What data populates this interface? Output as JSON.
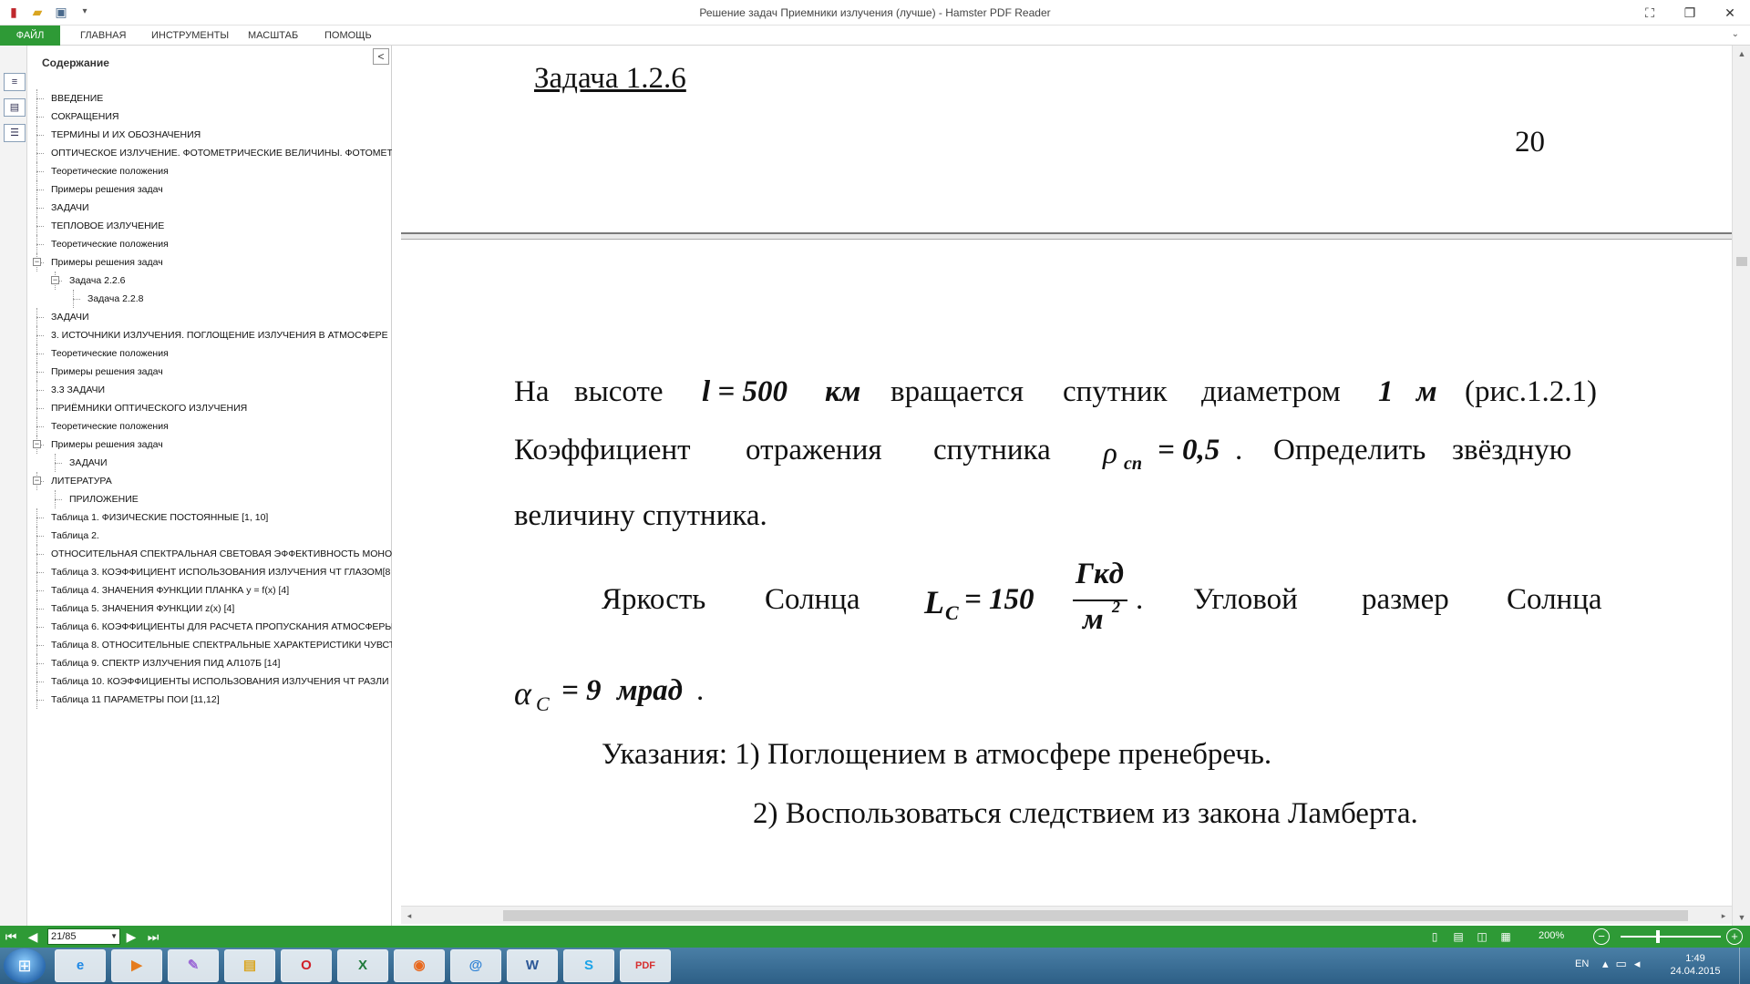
{
  "window": {
    "title": "Решение задач Приемники излучения (лучше) - Hamster PDF Reader",
    "controls": {
      "fullscreen": "⛶",
      "restore": "❐",
      "close": "✕"
    }
  },
  "quick_access": [
    "pdf-app-icon",
    "open-folder-icon",
    "print-icon",
    "customize-arrow-icon"
  ],
  "ribbon": {
    "tabs": [
      "ФАЙЛ",
      "ГЛАВНАЯ",
      "ИНСТРУМЕНТЫ",
      "МАСШТАБ",
      "ПОМОЩЬ"
    ],
    "colors": {
      "accent": "#2e9a36"
    }
  },
  "sidebar": {
    "title": "Содержание",
    "collapse_glyph": "<",
    "items": [
      {
        "label": "ВВЕДЕНИЕ",
        "level": 0,
        "expander": ""
      },
      {
        "label": "СОКРАЩЕНИЯ",
        "level": 0,
        "expander": ""
      },
      {
        "label": "ТЕРМИНЫ И ИХ ОБОЗНАЧЕНИЯ",
        "level": 0,
        "expander": ""
      },
      {
        "label": "ОПТИЧЕСКОЕ ИЗЛУЧЕНИЕ. ФОТОМЕТРИЧЕСКИЕ ВЕЛИЧИНЫ. ФОТОМЕТ",
        "level": 0,
        "expander": ""
      },
      {
        "label": "Теоретические положения",
        "level": 0,
        "expander": ""
      },
      {
        "label": "Примеры решения задач",
        "level": 0,
        "expander": ""
      },
      {
        "label": "ЗАДАЧИ",
        "level": 0,
        "expander": ""
      },
      {
        "label": "ТЕПЛОВОЕ ИЗЛУЧЕНИЕ",
        "level": 0,
        "expander": ""
      },
      {
        "label": "Теоретические положения",
        "level": 0,
        "expander": ""
      },
      {
        "label": "Примеры решения задач",
        "level": 0,
        "expander": "−"
      },
      {
        "label": "Задача 2.2.6",
        "level": 1,
        "expander": "−"
      },
      {
        "label": "Задача 2.2.8",
        "level": 2,
        "expander": ""
      },
      {
        "label": "ЗАДАЧИ",
        "level": 0,
        "expander": ""
      },
      {
        "label": "3. ИСТОЧНИКИ ИЗЛУЧЕНИЯ. ПОГЛОЩЕНИЕ ИЗЛУЧЕНИЯ В АТМОСФЕРЕ",
        "level": 0,
        "expander": ""
      },
      {
        "label": "Теоретические положения",
        "level": 0,
        "expander": ""
      },
      {
        "label": "Примеры решения задач",
        "level": 0,
        "expander": ""
      },
      {
        "label": "3.3 ЗАДАЧИ",
        "level": 0,
        "expander": ""
      },
      {
        "label": "ПРИЁМНИКИ ОПТИЧЕСКОГО ИЗЛУЧЕНИЯ",
        "level": 0,
        "expander": ""
      },
      {
        "label": "Теоретические положения",
        "level": 0,
        "expander": ""
      },
      {
        "label": "Примеры решения задач",
        "level": 0,
        "expander": "−"
      },
      {
        "label": "ЗАДАЧИ",
        "level": 1,
        "expander": ""
      },
      {
        "label": "ЛИТЕРАТУРА",
        "level": 0,
        "expander": "−"
      },
      {
        "label": "ПРИЛОЖЕНИЕ",
        "level": 1,
        "expander": ""
      },
      {
        "label": "Таблица 1. ФИЗИЧЕСКИЕ ПОСТОЯННЫЕ [1, 10]",
        "level": 0,
        "expander": ""
      },
      {
        "label": "Таблица 2.",
        "level": 0,
        "expander": ""
      },
      {
        "label": "ОТНОСИТЕЛЬНАЯ СПЕКТРАЛЬНАЯ СВЕТОВАЯ ЭФФЕКТИВНОСТЬ МОНОХ",
        "level": 0,
        "expander": ""
      },
      {
        "label": "Таблица 3. КОЭФФИЦИЕНТ ИСПОЛЬЗОВАНИЯ ИЗЛУЧЕНИЯ ЧТ ГЛАЗОМ[8",
        "level": 0,
        "expander": ""
      },
      {
        "label": "Таблица 4. ЗНАЧЕНИЯ ФУНКЦИИ ПЛАНКА y = f(x) [4]",
        "level": 0,
        "expander": ""
      },
      {
        "label": "Таблица 5. ЗНАЧЕНИЯ ФУНКЦИИ z(x) [4]",
        "level": 0,
        "expander": ""
      },
      {
        "label": "Таблица 6. КОЭФФИЦИЕНТЫ ДЛЯ РАСЧЕТА ПРОПУСКАНИЯ АТМОСФЕРЫ",
        "level": 0,
        "expander": ""
      },
      {
        "label": "Таблица 8. ОТНОСИТЕЛЬНЫЕ СПЕКТРАЛЬНЫЕ ХАРАКТЕРИСТИКИ ЧУВСТВ",
        "level": 0,
        "expander": ""
      },
      {
        "label": "Таблица 9. СПЕКТР ИЗЛУЧЕНИЯ ПИД АЛ107Б [14]",
        "level": 0,
        "expander": ""
      },
      {
        "label": "Таблица 10. КОЭФФИЦИЕНТЫ ИСПОЛЬЗОВАНИЯ ИЗЛУЧЕНИЯ ЧТ РАЗЛИ",
        "level": 0,
        "expander": ""
      },
      {
        "label": "Таблица 11 ПАРАМЕТРЫ ПОИ [11,12]",
        "level": 0,
        "expander": ""
      }
    ]
  },
  "document": {
    "heading": "Задача 1.2.6",
    "page_number": "20",
    "p1": {
      "w1": "На",
      "w2": "высоте",
      "math1": "l = 500",
      "unit1": "км",
      "w3": "вращается",
      "w4": "спутник",
      "w5": "диаметром",
      "math2": "1",
      "unit2": "м",
      "ref": "(рис.1.2.1)"
    },
    "p2": {
      "w1": "Коэффициент",
      "w2": "отражения",
      "w3": "спутника",
      "rho": "ρ",
      "rho_sub": "сп",
      "eq": "= 0,5",
      "dot": ".",
      "w4": "Определить",
      "w5": "звёздную"
    },
    "p3": "величину спутника.",
    "p4": {
      "w1": "Яркость",
      "w2": "Солнца",
      "L": "L",
      "L_sub": "C",
      "eq": "= 150",
      "num": "Гкд",
      "den": "м",
      "den_sup": "2",
      "dot": ".",
      "w3": "Угловой",
      "w4": "размер",
      "w5": "Солнца"
    },
    "p5": {
      "alpha": "α",
      "alpha_sub": "C",
      "eq": "= 9",
      "unit": "мрад",
      "dot": "."
    },
    "p6": "Указания: 1) Поглощением в атмосфере пренебречь.",
    "p7": "2) Воспользоваться следствием из закона Ламберта."
  },
  "statusbar": {
    "page_field": "21/85",
    "zoom": "200%",
    "zoom_level_percent": 35,
    "nav_icons": [
      "first-page-icon",
      "prev-page-icon",
      "next-page-icon",
      "last-page-icon"
    ],
    "view_icons": [
      "single-page-icon",
      "continuous-icon",
      "two-page-icon",
      "two-page-continuous-icon"
    ]
  },
  "taskbar": {
    "apps": [
      {
        "name": "ie",
        "glyph": "e"
      },
      {
        "name": "media-player",
        "glyph": "▶"
      },
      {
        "name": "paint",
        "glyph": "✎"
      },
      {
        "name": "explorer",
        "glyph": "▤"
      },
      {
        "name": "opera",
        "glyph": "O"
      },
      {
        "name": "excel",
        "glyph": "X"
      },
      {
        "name": "firefox",
        "glyph": "◉"
      },
      {
        "name": "mail",
        "glyph": "@"
      },
      {
        "name": "word",
        "glyph": "W"
      },
      {
        "name": "skype",
        "glyph": "S"
      },
      {
        "name": "pdf-reader",
        "glyph": "PDF"
      }
    ],
    "lang": "EN",
    "time": "1:49",
    "date": "24.04.2015"
  }
}
